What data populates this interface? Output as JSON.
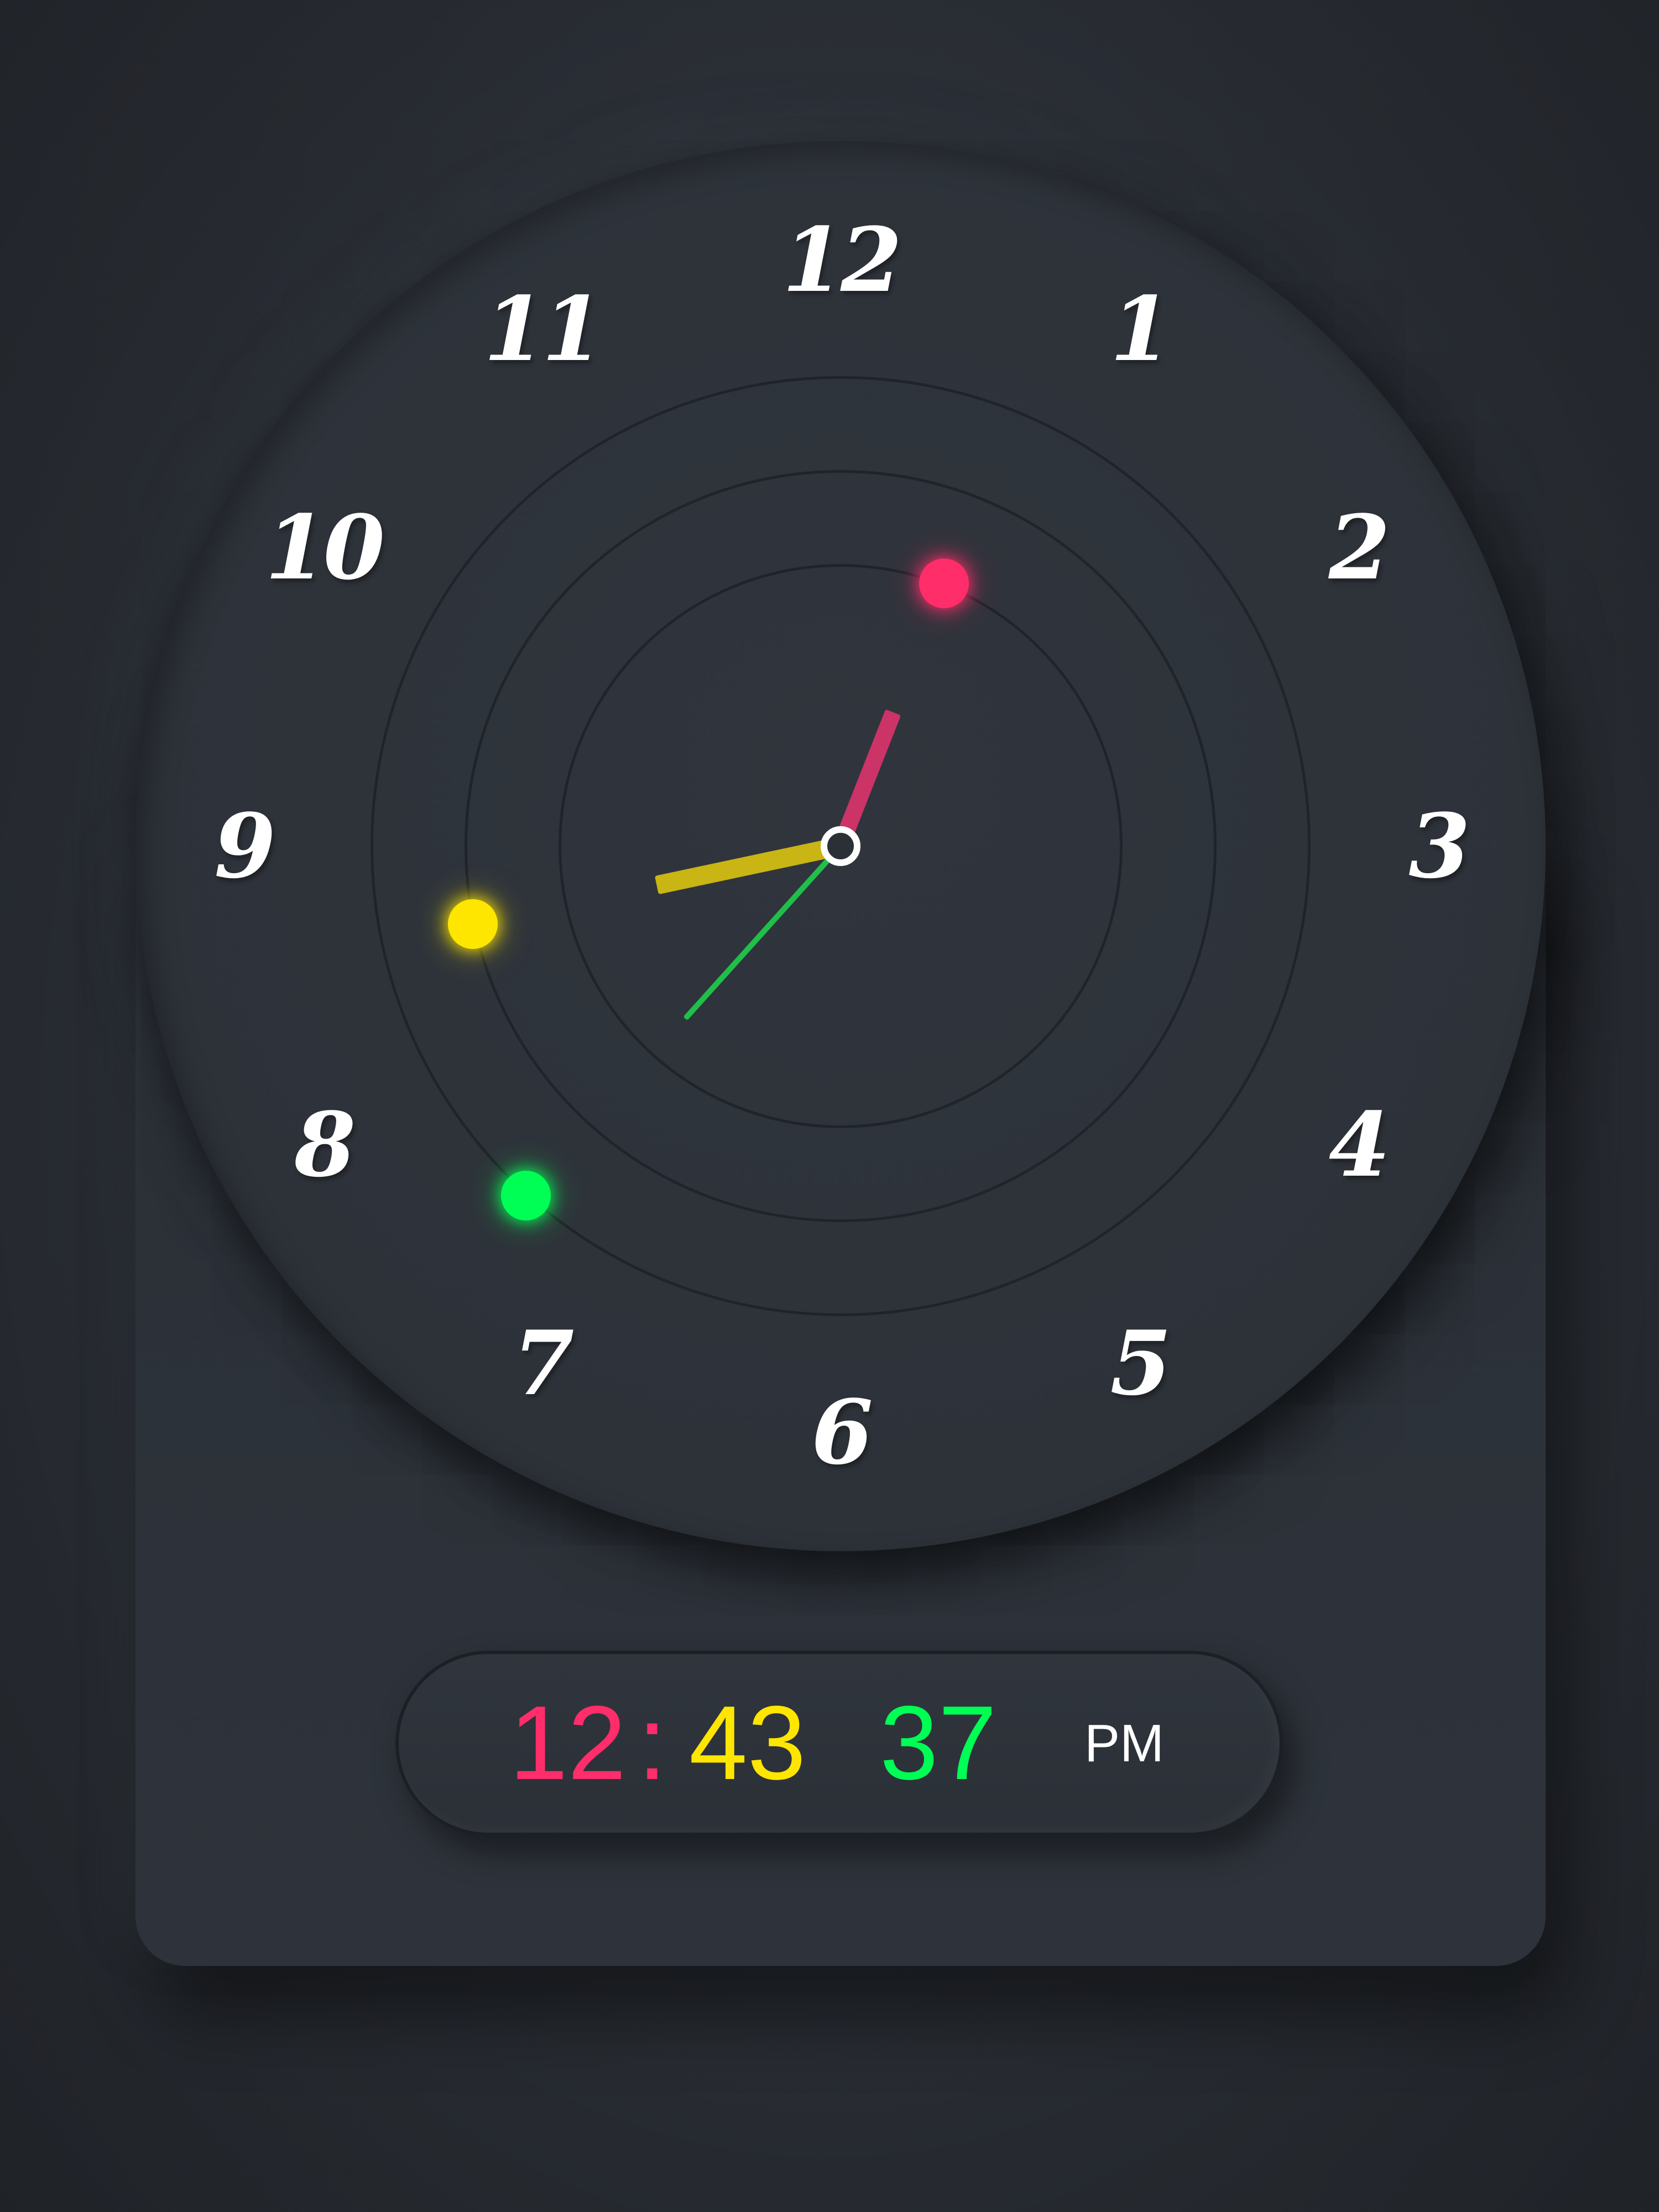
{
  "clock": {
    "numerals": [
      "12",
      "1",
      "2",
      "3",
      "4",
      "5",
      "6",
      "7",
      "8",
      "9",
      "10",
      "11"
    ],
    "hands": {
      "hour_angle_deg": 21.5,
      "minute_angle_deg": 258,
      "second_angle_deg": 222
    },
    "colors": {
      "hour": "#cc3366",
      "minute": "#c9b514",
      "second": "#1fbf4a",
      "hour_dot": "#ff2d6a",
      "minute_dot": "#ffe600",
      "second_dot": "#00ff55"
    }
  },
  "digital": {
    "hours": "12",
    "separator": ":",
    "minutes": "43",
    "seconds": "37",
    "ampm": "PM",
    "colors": {
      "hours": "#ff2d6a",
      "separator": "#ff2d6a",
      "minutes": "#ffe600",
      "seconds": "#00ff55",
      "ampm": "#ffffff"
    }
  }
}
